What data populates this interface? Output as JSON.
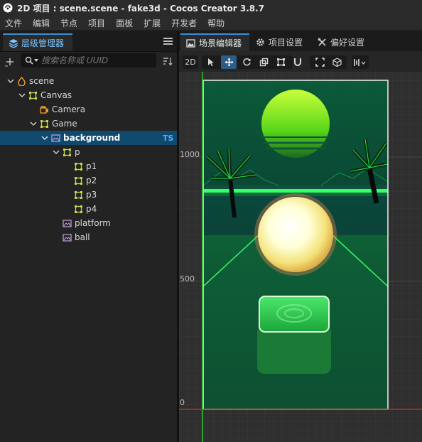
{
  "window": {
    "title": "2D 项目 : scene.scene - fake3d - Cocos Creator 3.8.7"
  },
  "menu": [
    "文件",
    "编辑",
    "节点",
    "项目",
    "面板",
    "扩展",
    "开发者",
    "帮助"
  ],
  "hierarchy": {
    "tab_label": "层级管理器",
    "search_placeholder": "搜索名称或 UUID",
    "nodes": [
      {
        "label": "scene",
        "expanded": true,
        "icon": "scene-icon"
      },
      {
        "label": "Canvas",
        "expanded": true,
        "icon": "node-icon"
      },
      {
        "label": "Camera",
        "icon": "camera-icon"
      },
      {
        "label": "Game",
        "expanded": true,
        "icon": "node-icon"
      },
      {
        "label": "background",
        "expanded": true,
        "icon": "sprite-icon",
        "selected": true,
        "badge": "TS"
      },
      {
        "label": "p",
        "expanded": true,
        "icon": "node-icon"
      },
      {
        "label": "p1",
        "icon": "node-icon"
      },
      {
        "label": "p2",
        "icon": "node-icon"
      },
      {
        "label": "p3",
        "icon": "node-icon"
      },
      {
        "label": "p4",
        "icon": "node-icon"
      },
      {
        "label": "platform",
        "icon": "sprite-icon"
      },
      {
        "label": "ball",
        "icon": "sprite-icon"
      }
    ]
  },
  "editor_tabs": [
    {
      "label": "场景编辑器",
      "icon": "scene-editor-icon",
      "active": true
    },
    {
      "label": "项目设置",
      "icon": "gear-icon",
      "active": false
    },
    {
      "label": "偏好设置",
      "icon": "tools-icon",
      "active": false
    }
  ],
  "scene_toolbar": {
    "mode_label": "2D",
    "tools": [
      "select-icon",
      "move-icon",
      "rotate-icon",
      "scale-icon",
      "rect-icon",
      "magnet-icon",
      "snap-icon",
      "gizmo-3d-icon",
      "align-icon"
    ],
    "selected_tool": "move-icon"
  },
  "rulers": {
    "y_labels": [
      "1000",
      "500",
      "0"
    ]
  },
  "colors": {
    "accent": "#3a8fd6",
    "selection": "#0f4a6e",
    "neon_green": "#22ff55",
    "axis_red": "#c0392b"
  }
}
